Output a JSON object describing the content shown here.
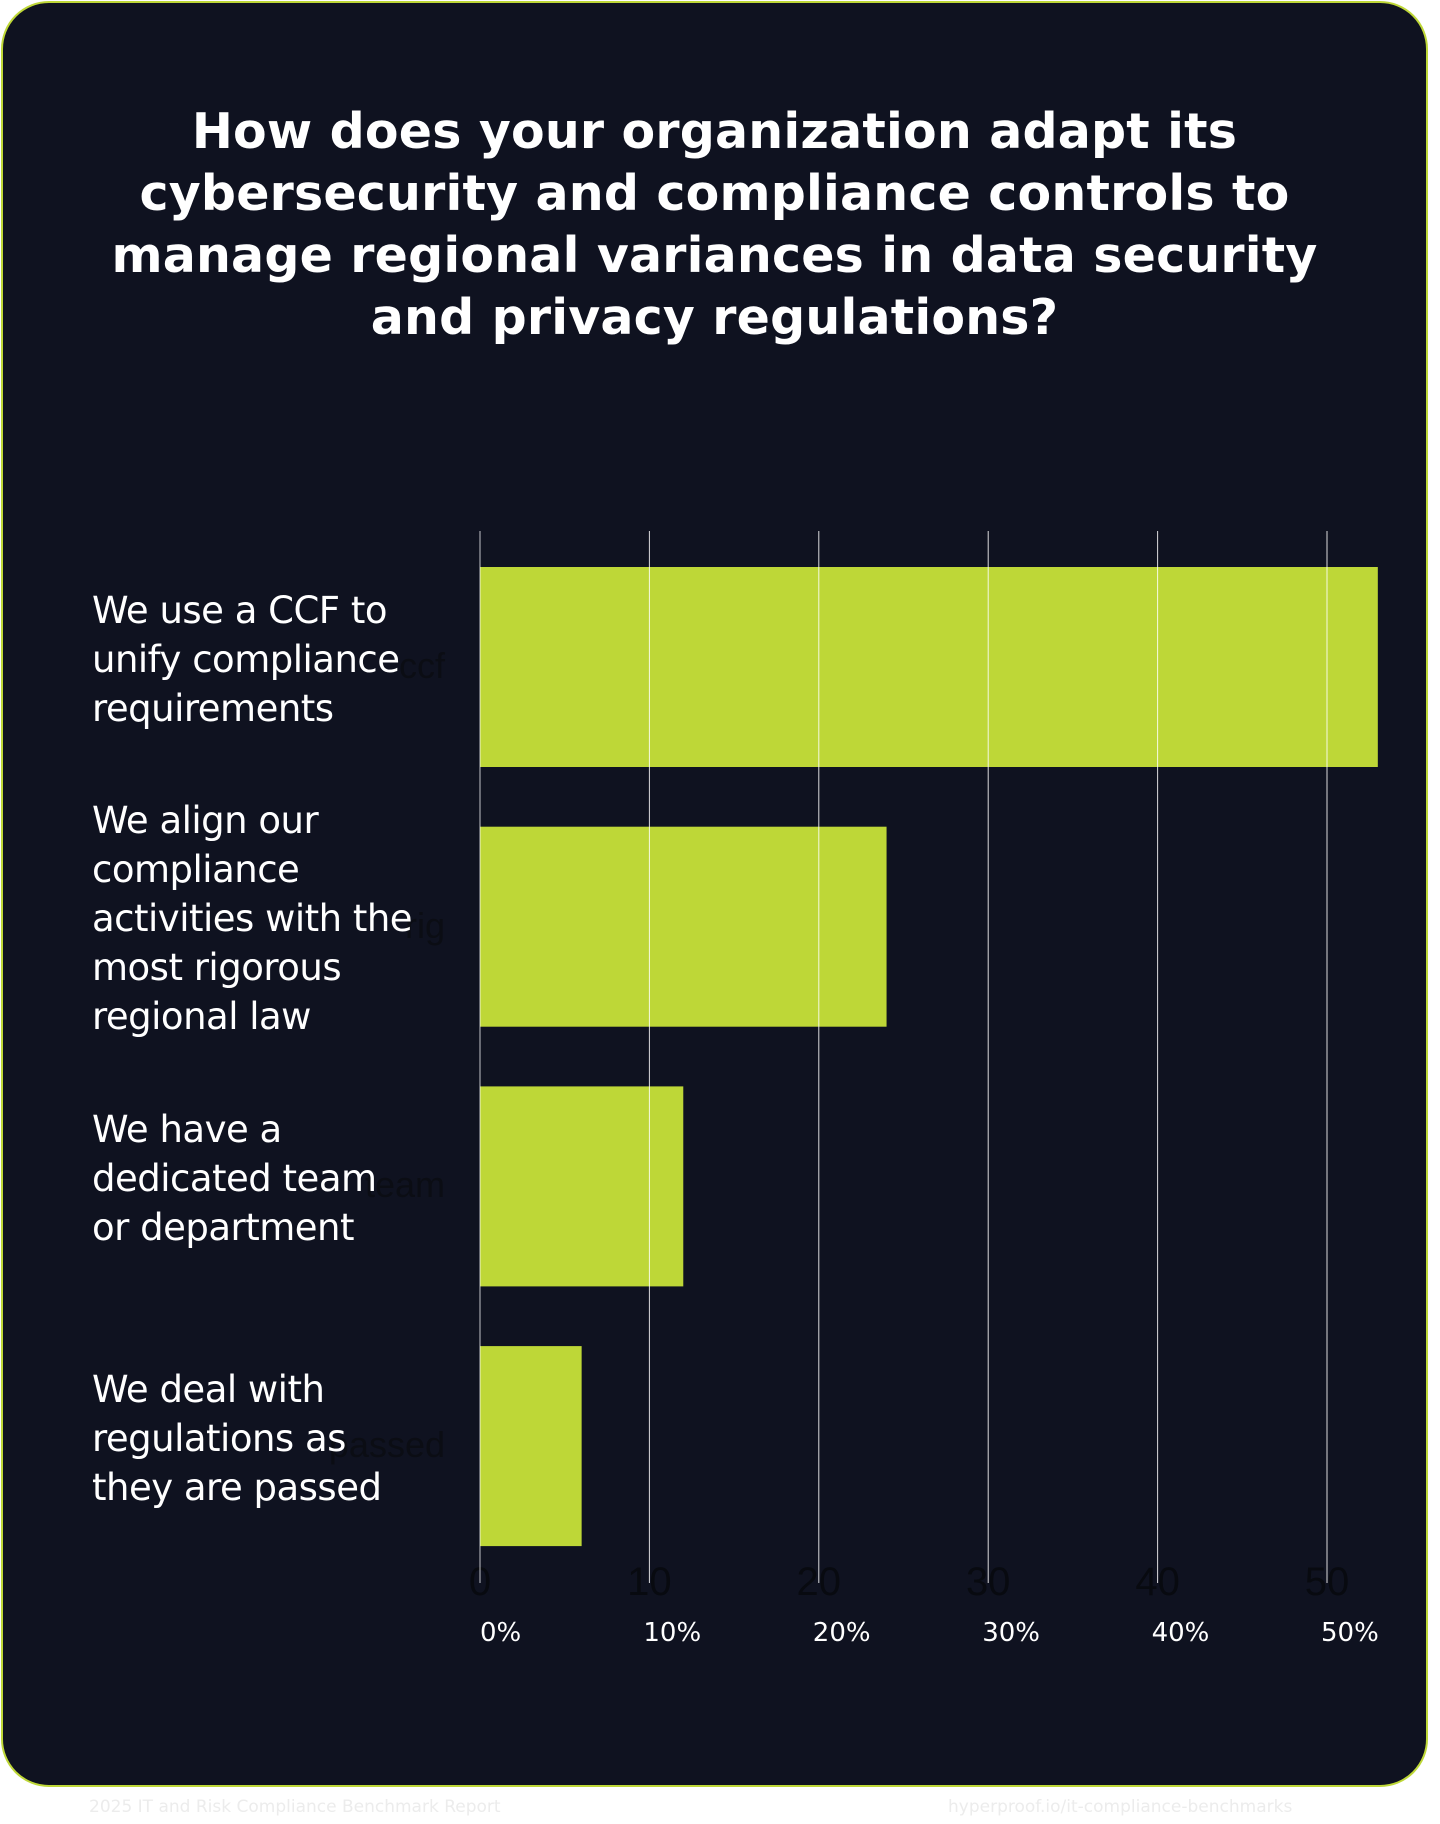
{
  "title_lines": [
    "How does your organization adapt its",
    "cybersecurity and compliance controls to",
    "manage regional variances in data security",
    "and privacy regulations?"
  ],
  "colors": {
    "background": "#0F1220",
    "bar": "#BED737",
    "border": "#BED737",
    "text": "#FFFFFF",
    "gridline": "#FFFFFF"
  },
  "chart_data": {
    "type": "bar",
    "orientation": "horizontal",
    "title": "How does your organization adapt its cybersecurity and compliance controls to manage regional variances in data security and privacy regulations?",
    "categories": [
      "We use a CCF to unify compliance requirements",
      "We align our compliance activities with the most rigorous regional law",
      "We have a dedicated team or department",
      "We deal with regulations as they are passed"
    ],
    "category_label_lines": [
      [
        "We use a CCF to",
        "unify compliance",
        "requirements"
      ],
      [
        "We align our",
        "compliance",
        "activities with the",
        "most rigorous",
        "regional law"
      ],
      [
        "We have a",
        "dedicated team",
        "or department"
      ],
      [
        "We deal with",
        "regulations as",
        "they are passed"
      ]
    ],
    "ghost_labels": [
      "ccf",
      "rig",
      "team",
      "passed"
    ],
    "values": [
      53,
      24,
      12,
      6
    ],
    "unit": "%",
    "xlim": [
      0,
      55
    ],
    "xticks": [
      0,
      10,
      20,
      30,
      40,
      50
    ],
    "xtick_raw_labels": [
      "0",
      "10",
      "20",
      "30",
      "40",
      "50"
    ],
    "xtick_labels": [
      "0%",
      "10%",
      "20%",
      "30%",
      "40%",
      "50%"
    ],
    "xlabel": "",
    "ylabel": "",
    "grid": "vertical",
    "legend": "none"
  },
  "footer": {
    "left": "2025 IT and Risk Compliance Benchmark Report",
    "right": "hyperproof.io/it-compliance-benchmarks"
  }
}
